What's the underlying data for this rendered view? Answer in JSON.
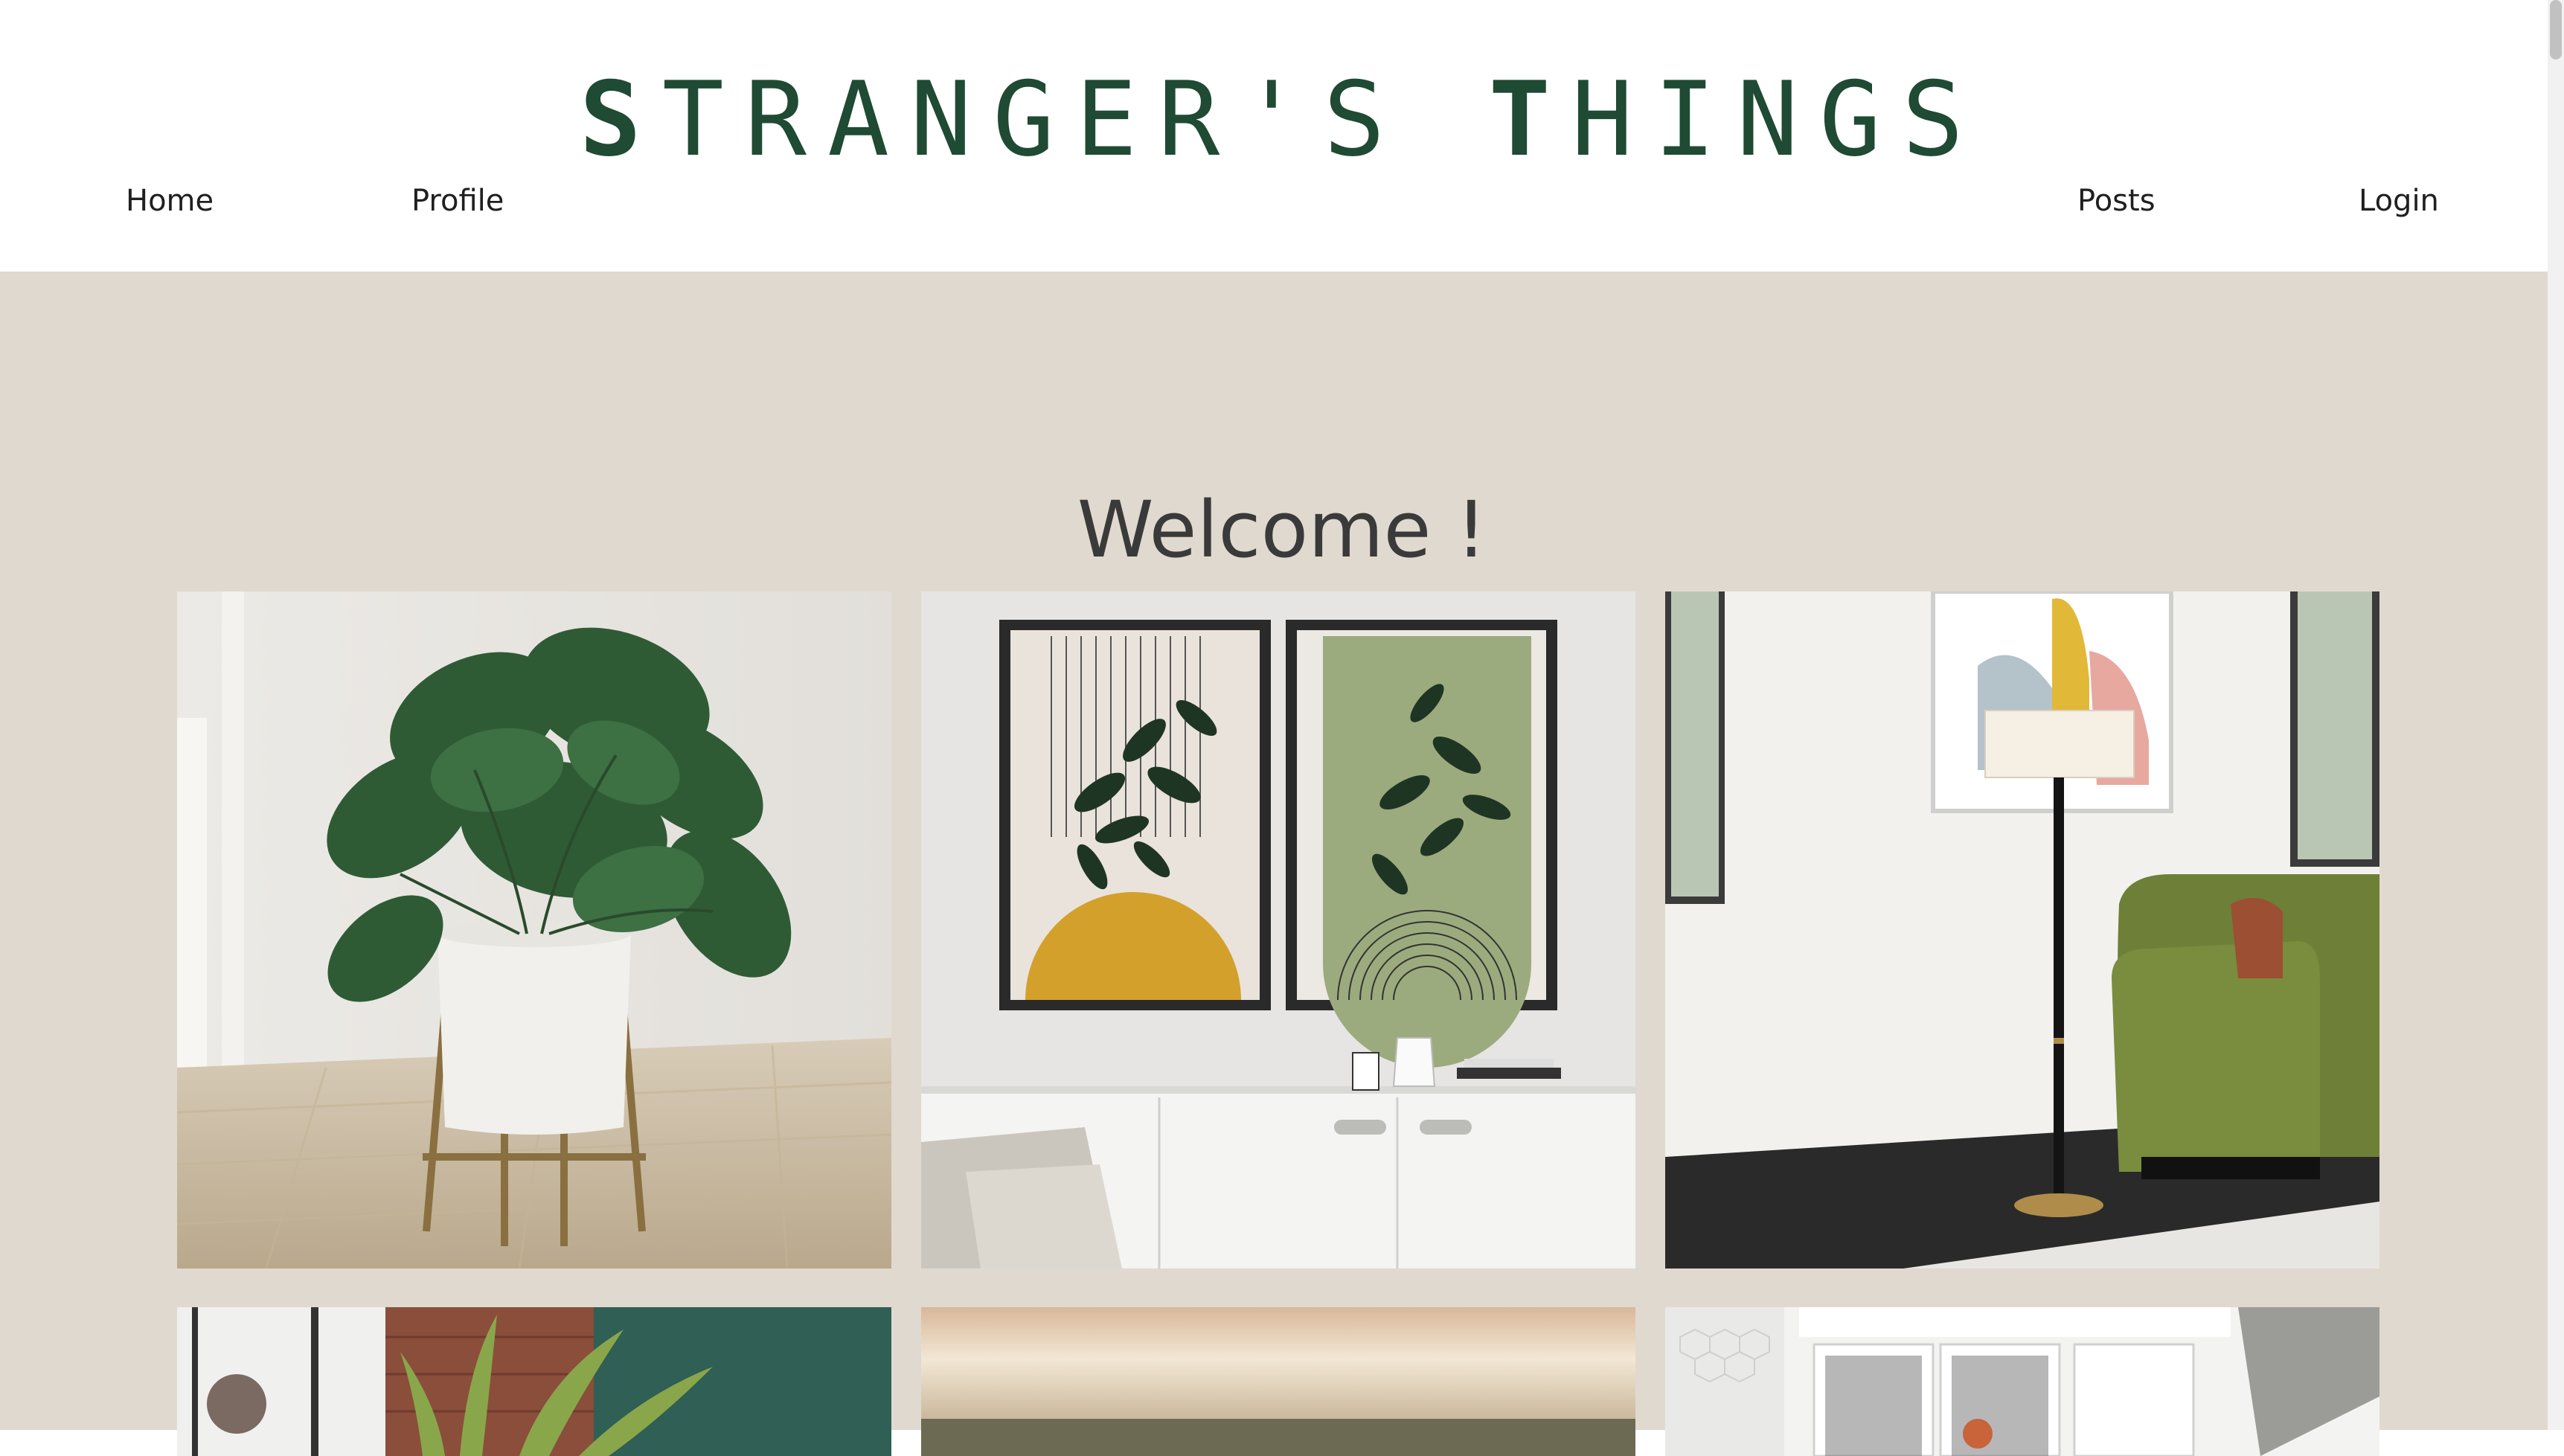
{
  "header": {
    "brand_first": "S",
    "brand_mid1": "TRANGER'S ",
    "brand_second": "T",
    "brand_mid2": "HINGS",
    "nav": {
      "home": "Home",
      "profile": "Profile",
      "posts": "Posts",
      "login": "Login"
    }
  },
  "main": {
    "welcome": "Welcome !",
    "background_color": "#e0d9cf"
  },
  "colors": {
    "brand": "#1f4a33",
    "text": "#1f1f1f"
  }
}
